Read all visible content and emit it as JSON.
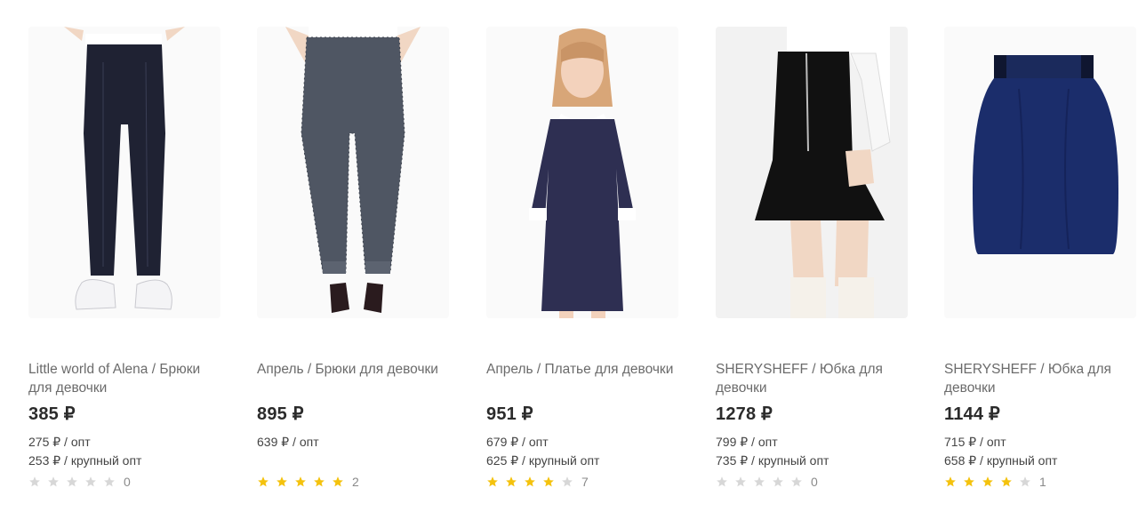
{
  "products": [
    {
      "brand": "Little world of Alena",
      "title": "Little world of Alena / Брюки для девочки",
      "price": "385 ₽",
      "opt": "275 ₽ / опт",
      "large_opt": "253 ₽ / крупный опт",
      "rating": 0,
      "reviews": "0",
      "image": "black-trousers"
    },
    {
      "brand": "Апрель",
      "title": "Апрель / Брюки для девочки",
      "price": "895 ₽",
      "opt": "639 ₽ / опт",
      "large_opt": "",
      "rating": 5,
      "reviews": "2",
      "image": "grey-trousers"
    },
    {
      "brand": "Апрель",
      "title": "Апрель / Платье для девочки",
      "price": "951 ₽",
      "opt": "679 ₽ / опт",
      "large_opt": "625 ₽ / крупный опт",
      "rating": 4,
      "reviews": "7",
      "image": "navy-dress"
    },
    {
      "brand": "SHERYSHEFF",
      "title": "SHERYSHEFF / Юбка для девочки",
      "price": "1278 ₽",
      "opt": "799 ₽ / опт",
      "large_opt": "735 ₽ / крупный опт",
      "rating": 0,
      "reviews": "0",
      "image": "black-skirt"
    },
    {
      "brand": "SHERYSHEFF",
      "title": "SHERYSHEFF / Юбка для девочки",
      "price": "1144 ₽",
      "opt": "715 ₽ / опт",
      "large_opt": "658 ₽ / крупный опт",
      "rating": 4,
      "reviews": "1",
      "image": "navy-skirt"
    }
  ],
  "colors": {
    "star_on": "#f4c20d",
    "star_off": "#d7d7d7",
    "title_text": "#6b6b6b",
    "price_text": "#2b2b2b"
  }
}
